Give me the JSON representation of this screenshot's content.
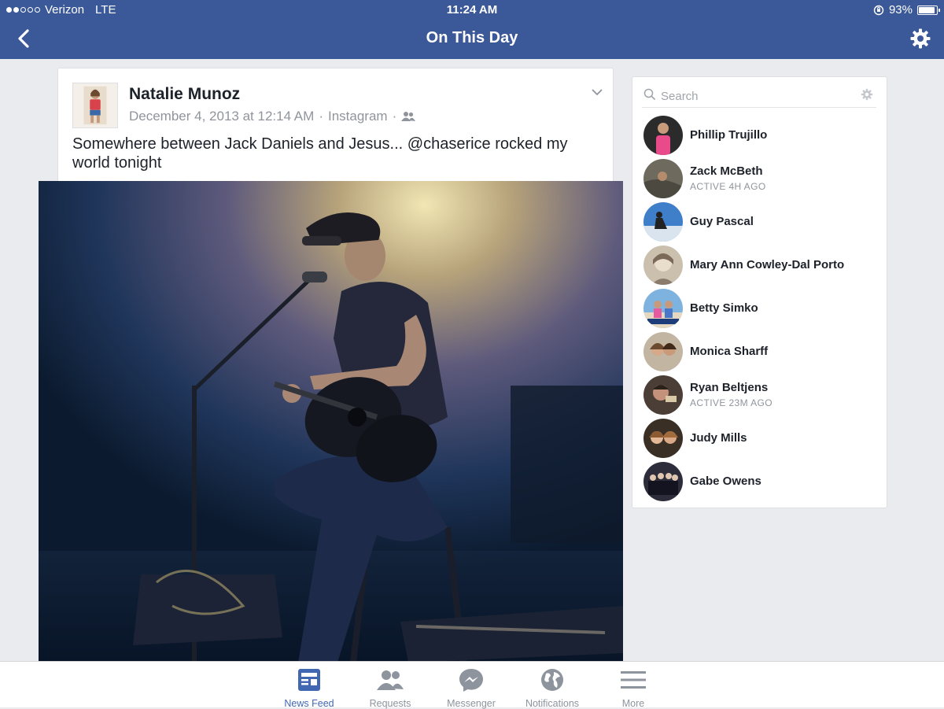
{
  "status_bar": {
    "carrier": "Verizon",
    "network": "LTE",
    "time": "11:24 AM",
    "battery": "93%",
    "battery_level": 0.93,
    "signal_bars_filled": 2,
    "signal_bars_total": 5
  },
  "nav": {
    "title": "On This Day"
  },
  "post": {
    "author": "Natalie Munoz",
    "date": "December 4, 2013 at 12:14 AM",
    "source": "Instagram",
    "text": "Somewhere between Jack Daniels and Jesus... @chaserice rocked my world tonight"
  },
  "sidebar": {
    "search_placeholder": "Search",
    "friends": [
      {
        "name": "Phillip Trujillo",
        "status": ""
      },
      {
        "name": "Zack McBeth",
        "status": "ACTIVE 4H AGO"
      },
      {
        "name": "Guy Pascal",
        "status": ""
      },
      {
        "name": "Mary Ann Cowley-Dal Porto",
        "status": ""
      },
      {
        "name": "Betty Simko",
        "status": ""
      },
      {
        "name": "Monica Sharff",
        "status": ""
      },
      {
        "name": "Ryan Beltjens",
        "status": "ACTIVE 23M AGO"
      },
      {
        "name": "Judy Mills",
        "status": ""
      },
      {
        "name": "Gabe Owens",
        "status": ""
      }
    ]
  },
  "tabs": [
    {
      "label": "News Feed",
      "active": true
    },
    {
      "label": "Requests",
      "active": false
    },
    {
      "label": "Messenger",
      "active": false
    },
    {
      "label": "Notifications",
      "active": false
    },
    {
      "label": "More",
      "active": false
    }
  ],
  "colors": {
    "brand": "#3b5998",
    "active_tab": "#4267b2",
    "inactive_tab": "#8d949e"
  }
}
